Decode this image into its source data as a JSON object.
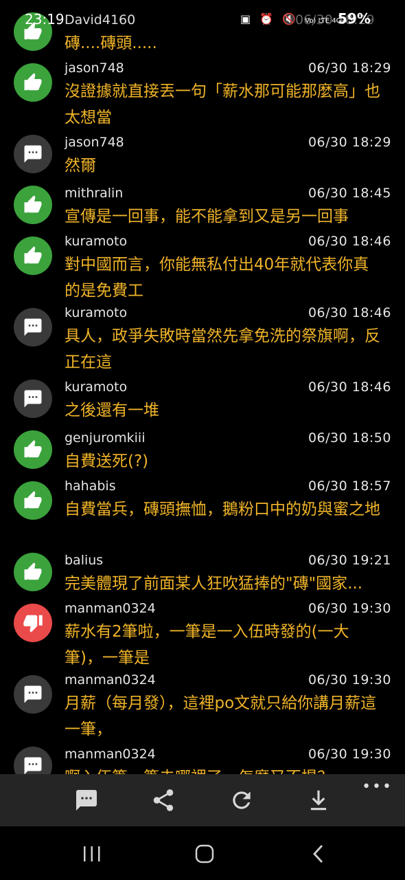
{
  "status_bar": {
    "time": "23:19",
    "partial_user": "David4160",
    "battery": "59%",
    "ghost_time": "06/30 18:29",
    "network": "Vo) LTE 4G+"
  },
  "comments": [
    {
      "type": "like",
      "icon": "thumbs-up-icon",
      "username": "",
      "time": "",
      "text": "磚....磚頭....."
    },
    {
      "type": "like",
      "icon": "thumbs-up-icon",
      "username": "jason748",
      "time": "06/30 18:29",
      "text": "沒證據就直接丟一句「薪水那可能那麼高」也太想當"
    },
    {
      "type": "neutral",
      "icon": "speech-bubble-icon",
      "username": "jason748",
      "time": "06/30 18:29",
      "text": "然爾"
    },
    {
      "type": "like",
      "icon": "thumbs-up-icon",
      "username": "mithralin",
      "time": "06/30 18:45",
      "text": "宣傳是一回事，能不能拿到又是另一回事"
    },
    {
      "type": "like",
      "icon": "thumbs-up-icon",
      "username": "kuramoto",
      "time": "06/30 18:46",
      "text": "對中國而言，你能無私付出40年就代表你真的是免費工"
    },
    {
      "type": "neutral",
      "icon": "speech-bubble-icon",
      "username": "kuramoto",
      "time": "06/30 18:46",
      "text": "具人，政爭失敗時當然先拿免洗的祭旗啊，反正在這"
    },
    {
      "type": "neutral",
      "icon": "speech-bubble-icon",
      "username": "kuramoto",
      "time": "06/30 18:46",
      "text": "之後還有一堆"
    },
    {
      "type": "like",
      "icon": "thumbs-up-icon",
      "username": "genjuromkiii",
      "time": "06/30 18:50",
      "text": "自費送死(?)"
    },
    {
      "type": "like",
      "icon": "thumbs-up-icon",
      "username": "hahabis",
      "time": "06/30 18:57",
      "text": "自費當兵，磚頭撫恤，鵝粉口中的奶與蜜之地"
    },
    {
      "type": "like",
      "icon": "thumbs-up-icon",
      "username": "balius",
      "time": "06/30 19:21",
      "text": "完美體現了前面某人狂吹猛捧的\"磚\"國家..."
    },
    {
      "type": "dislike",
      "icon": "thumbs-down-icon",
      "username": "manman0324",
      "time": "06/30 19:30",
      "text": "薪水有2筆啦，一筆是一入伍時發的(一大筆)，一筆是"
    },
    {
      "type": "neutral",
      "icon": "speech-bubble-icon",
      "username": "manman0324",
      "time": "06/30 19:30",
      "text": "月薪（每月發），這裡po文就只給你講月薪這一筆，"
    },
    {
      "type": "neutral",
      "icon": "speech-bubble-icon",
      "username": "manman0324",
      "time": "06/30 19:30",
      "text": "啊入伍筆一筆去哪裡了，怎麼又不提？"
    }
  ],
  "toolbar": {
    "buttons": [
      {
        "name": "comment-button",
        "icon": "comment-icon"
      },
      {
        "name": "share-button",
        "icon": "share-icon"
      },
      {
        "name": "refresh-button",
        "icon": "refresh-icon"
      },
      {
        "name": "download-button",
        "icon": "download-icon"
      }
    ],
    "more": "•••"
  },
  "navbar": {
    "buttons": [
      "recent-apps",
      "home",
      "back"
    ]
  },
  "colors": {
    "comment_text": "#f0b429",
    "like": "#3ba23c",
    "dislike": "#ea4a4a",
    "neutral": "#3a3a3a",
    "toolbar_bg": "#252525"
  }
}
